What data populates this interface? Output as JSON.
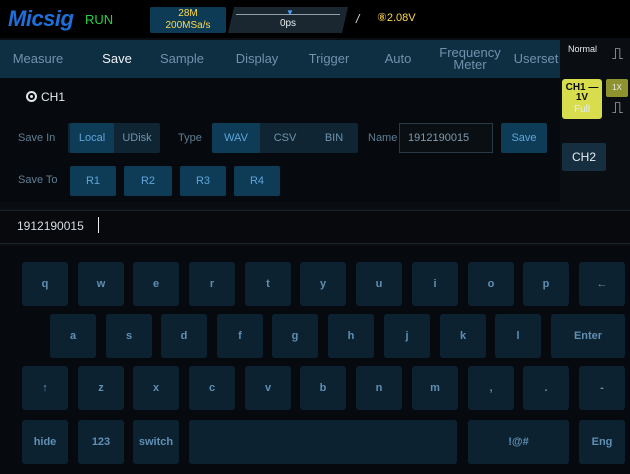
{
  "status": {
    "brand": "Micsig",
    "run_state": "RUN",
    "sample_depth": "28M",
    "sample_rate": "200MSa/s",
    "time_offset": "0ps",
    "trigger_slope": "/",
    "trigger_level": "⑧2.08V"
  },
  "menu": {
    "tabs": [
      "Measure",
      "Save",
      "Sample",
      "Display",
      "Trigger",
      "Auto",
      "Frequency\nMeter",
      "Userset"
    ],
    "active": "Save"
  },
  "right_panel": {
    "mode": "Normal",
    "ch1_label": "CH1 —",
    "ch1_scale": "1V",
    "probe": "1X",
    "bandwidth": "Full",
    "ch2_label": "CH2",
    "wave_glyph": "⎍"
  },
  "save": {
    "source_label": "CH1",
    "save_in_label": "Save In",
    "save_in_options": [
      "Local",
      "UDisk"
    ],
    "save_in_selected": "Local",
    "type_label": "Type",
    "type_options": [
      "WAV",
      "CSV",
      "BIN"
    ],
    "type_selected": "WAV",
    "name_label": "Name",
    "name_value": "1912190015",
    "save_button": "Save",
    "save_to_label": "Save To",
    "save_to_options": [
      "R1",
      "R2",
      "R3",
      "R4"
    ]
  },
  "input": {
    "value": "1912190015"
  },
  "keyboard": {
    "row1": [
      "q",
      "w",
      "e",
      "r",
      "t",
      "y",
      "u",
      "i",
      "o",
      "p",
      "←"
    ],
    "row2": [
      "a",
      "s",
      "d",
      "f",
      "g",
      "h",
      "j",
      "k",
      "l",
      "Enter"
    ],
    "row3": [
      "↑",
      "z",
      "x",
      "c",
      "v",
      "b",
      "n",
      "m",
      ",",
      ".",
      "-"
    ],
    "row4": [
      "hide",
      "123",
      "switch",
      "",
      "!@#",
      "Eng"
    ]
  },
  "colors": {
    "accent_blue": "#1f6fd8",
    "run_green": "#28d04a",
    "trigger_yellow": "#ffd84a",
    "ch1_yellow": "#d8dd4e"
  }
}
